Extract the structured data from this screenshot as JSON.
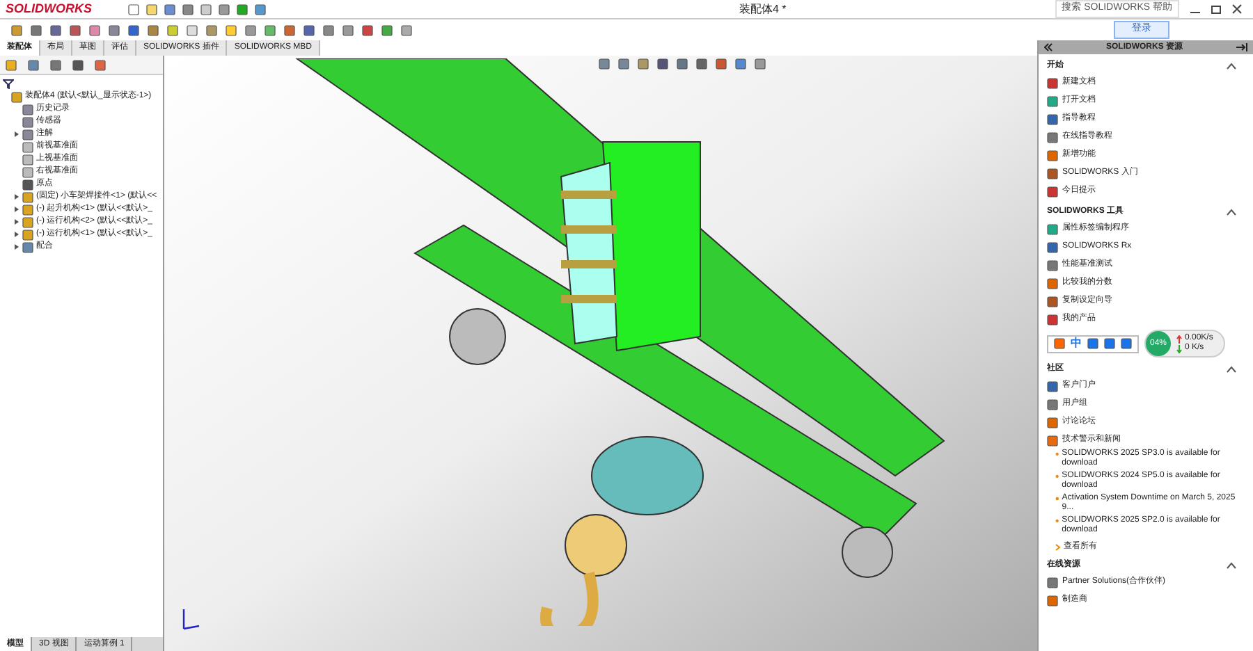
{
  "app": {
    "logo": "SOLIDWORKS",
    "title": "装配体4 *",
    "search": "搜索 SOLIDWORKS 帮助",
    "login": "登录"
  },
  "command_tabs": [
    {
      "label": "装配体",
      "selected": true
    },
    {
      "label": "布局",
      "selected": false
    },
    {
      "label": "草图",
      "selected": false
    },
    {
      "label": "评估",
      "selected": false
    },
    {
      "label": "SOLIDWORKS 插件",
      "selected": false
    },
    {
      "label": "SOLIDWORKS MBD",
      "selected": false
    }
  ],
  "feature_tree": {
    "root": {
      "label": "装配体4 (默认<默认_显示状态-1>)",
      "kind": "assembly",
      "children": [
        {
          "label": "历史记录",
          "kind": "folder"
        },
        {
          "label": "传感器",
          "kind": "folder"
        },
        {
          "label": "注解",
          "kind": "folder",
          "expandable": true
        },
        {
          "label": "前视基准面",
          "kind": "plane"
        },
        {
          "label": "上视基准面",
          "kind": "plane"
        },
        {
          "label": "右视基准面",
          "kind": "plane"
        },
        {
          "label": "原点",
          "kind": "origin"
        },
        {
          "label": "(固定) 小车架焊接件<1> (默认<<",
          "kind": "component",
          "expandable": true
        },
        {
          "label": "(-) 起升机构<1> (默认<<默认>_",
          "kind": "component",
          "expandable": true
        },
        {
          "label": "(-) 运行机构<2> (默认<<默认>_",
          "kind": "component",
          "expandable": true
        },
        {
          "label": "(-) 运行机构<1> (默认<<默认>_",
          "kind": "component",
          "expandable": true
        },
        {
          "label": "配合",
          "kind": "mates",
          "expandable": true
        }
      ]
    }
  },
  "bottom_tabs": [
    {
      "label": "模型",
      "selected": true
    },
    {
      "label": "3D 视图",
      "selected": false
    },
    {
      "label": "运动算例 1",
      "selected": false
    }
  ],
  "task_pane": {
    "title": "SOLIDWORKS 资源",
    "sections": [
      {
        "title": "开始",
        "expanded": true,
        "items": [
          {
            "label": "新建文档",
            "kind": "link"
          },
          {
            "label": "打开文档",
            "kind": "link"
          },
          {
            "label": "指导教程",
            "kind": "link"
          },
          {
            "label": "在线指导教程",
            "kind": "link"
          },
          {
            "label": "新增功能",
            "kind": "link"
          },
          {
            "label": "SOLIDWORKS 入门",
            "kind": "link"
          },
          {
            "label": "今日提示",
            "kind": "link"
          }
        ]
      },
      {
        "title": "SOLIDWORKS 工具",
        "expanded": true,
        "items": [
          {
            "label": "属性标签编制程序",
            "kind": "link"
          },
          {
            "label": "SOLIDWORKS Rx",
            "kind": "link"
          },
          {
            "label": "性能基准测试",
            "kind": "link"
          },
          {
            "label": "比较我的分数",
            "kind": "link"
          },
          {
            "label": "复制设定向导",
            "kind": "link"
          },
          {
            "label": "我的产品",
            "kind": "link"
          }
        ]
      },
      {
        "title": "社区",
        "expanded": true,
        "items": [
          {
            "label": "客户门户",
            "kind": "link"
          },
          {
            "label": "用户组",
            "kind": "link"
          },
          {
            "label": "讨论论坛",
            "kind": "link"
          },
          {
            "label": "技术警示和新闻",
            "kind": "feed"
          },
          {
            "label": "SOLIDWORKS 2025 SP3.0 is available for download",
            "kind": "news"
          },
          {
            "label": "SOLIDWORKS 2024 SP5.0 is available for download",
            "kind": "news"
          },
          {
            "label": "Activation System Downtime on March 5, 2025 9...",
            "kind": "news"
          },
          {
            "label": "SOLIDWORKS 2025 SP2.0 is available for download",
            "kind": "news"
          },
          {
            "label": "查看所有",
            "kind": "more"
          }
        ]
      },
      {
        "title": "在线资源",
        "expanded": true,
        "items": [
          {
            "label": "Partner Solutions(合作伙伴)",
            "kind": "link"
          },
          {
            "label": "制造商",
            "kind": "link"
          }
        ]
      }
    ]
  },
  "ime_bar": {
    "label": "中"
  },
  "net_widget": {
    "percent": "04%",
    "up": "0.00K/s",
    "down": "0 K/s"
  }
}
